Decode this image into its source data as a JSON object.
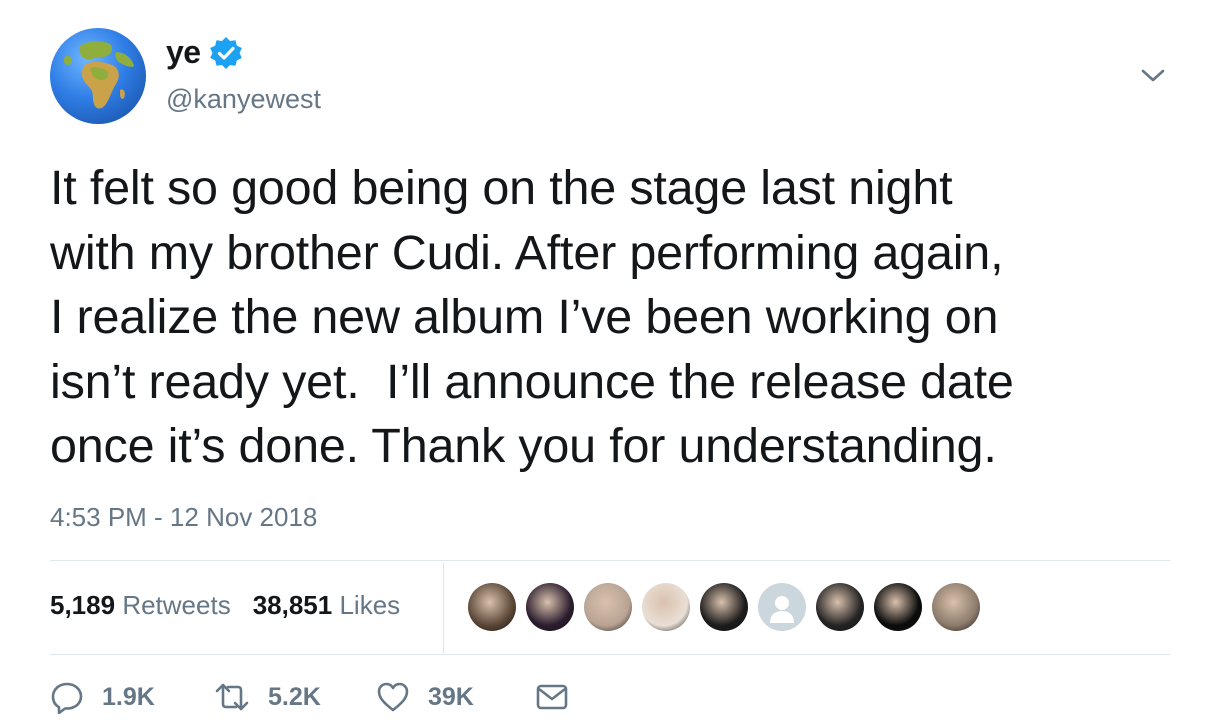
{
  "user": {
    "display_name": "ye",
    "handle": "@kanyewest",
    "avatar_icon": "earth-africa-globe-icon",
    "verified_icon": "verified-badge-icon",
    "verified_color": "#1da1f2"
  },
  "tweet": {
    "lines": [
      "It felt so good being on the stage last night",
      "with my brother Cudi. After performing again,",
      "I realize the new album I’ve been working on",
      "isn’t ready yet.  I’ll announce the release date",
      "once it’s done. Thank you for understanding."
    ],
    "timestamp": "4:53 PM - 12 Nov 2018"
  },
  "stats": {
    "retweets_count": "5,189",
    "retweets_label": "Retweets",
    "likes_count": "38,851",
    "likes_label": "Likes"
  },
  "likers": [
    {
      "icon": "liker-avatar-1",
      "color": "#5a4636"
    },
    {
      "icon": "liker-avatar-2",
      "color": "#2b1d2e"
    },
    {
      "icon": "liker-avatar-3",
      "color": "#b8a393"
    },
    {
      "icon": "liker-avatar-4",
      "color": "#e9dfd5"
    },
    {
      "icon": "liker-avatar-5",
      "color": "#1c1c1c"
    },
    {
      "icon": "default-avatar-icon",
      "color": "#ccd6dd"
    },
    {
      "icon": "liker-avatar-7",
      "color": "#242424"
    },
    {
      "icon": "liker-avatar-8",
      "color": "#0b0b0b"
    },
    {
      "icon": "liker-avatar-9",
      "color": "#8c7a6a"
    }
  ],
  "actions": {
    "reply_count": "1.9K",
    "retweet_count": "5.2K",
    "like_count": "39K",
    "reply_icon": "reply-icon",
    "retweet_icon": "retweet-icon",
    "like_icon": "heart-icon",
    "dm_icon": "envelope-icon"
  },
  "colors": {
    "text": "#14171a",
    "muted": "#657786",
    "divider": "#e1e8ed"
  }
}
